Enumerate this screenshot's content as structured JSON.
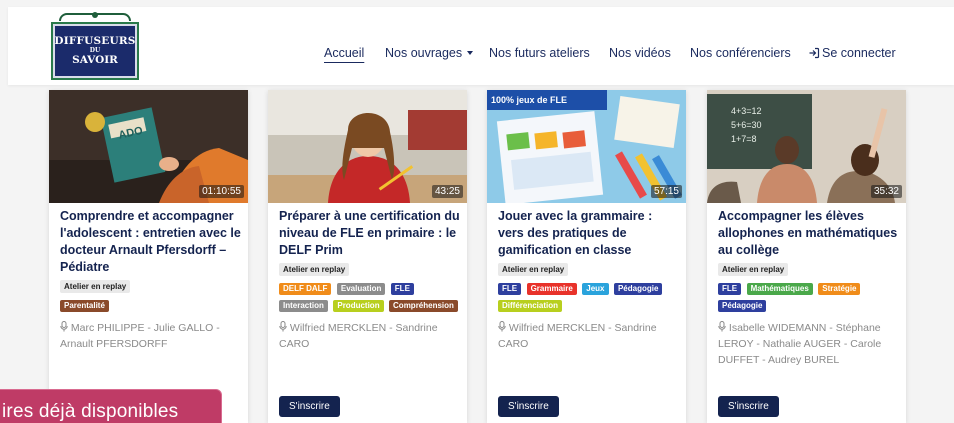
{
  "logo": {
    "line1": "DIFFUSEURS",
    "line2": "DU",
    "line3": "SAVOIR"
  },
  "nav": {
    "items": [
      {
        "label": "Accueil"
      },
      {
        "label": "Nos ouvrages"
      },
      {
        "label": "Nos futurs ateliers"
      },
      {
        "label": "Nos vidéos"
      },
      {
        "label": "Nos conférenciers"
      },
      {
        "label": "Se connecter"
      }
    ]
  },
  "cards": [
    {
      "title": "Comprendre et accompagner l'adolescent : entretien avec le docteur Arnault Pfersdorff – Pédiatre",
      "duration": "01:10:55",
      "badge": "Atelier en replay",
      "tags": [
        {
          "label": "Parentalité",
          "color": "#8a4a2a"
        }
      ],
      "speakers": "Marc PHILIPPE - Julie GALLO - Arnault PFERSDORFF",
      "button": ""
    },
    {
      "title": "Préparer à une certification du niveau de FLE en primaire : le DELF Prim",
      "duration": "43:25",
      "badge": "Atelier en replay",
      "tags": [
        {
          "label": "DELF DALF",
          "color": "#f08c1a"
        },
        {
          "label": "Evaluation",
          "color": "#8c8c8c"
        },
        {
          "label": "FLE",
          "color": "#2e3f9e"
        },
        {
          "label": "Interaction",
          "color": "#8c8c8c"
        },
        {
          "label": "Production",
          "color": "#b8cf1e"
        },
        {
          "label": "Compréhension",
          "color": "#8a4a2a"
        }
      ],
      "speakers": "Wilfried MERCKLEN - Sandrine CARO",
      "button": "S'inscrire"
    },
    {
      "title": "Jouer avec la grammaire : vers des pratiques de gamification en classe",
      "duration": "57:15",
      "badge": "Atelier en replay",
      "tags": [
        {
          "label": "FLE",
          "color": "#2e3f9e"
        },
        {
          "label": "Grammaire",
          "color": "#e8322a"
        },
        {
          "label": "Jeux",
          "color": "#2aa3dc"
        },
        {
          "label": "Pédagogie",
          "color": "#2e3f9e"
        },
        {
          "label": "Différenciation",
          "color": "#b8cf1e"
        }
      ],
      "speakers": "Wilfried MERCKLEN - Sandrine CARO",
      "button": "S'inscrire"
    },
    {
      "title": "Accompagner les élèves allophones en mathématiques au collège",
      "duration": "35:32",
      "badge": "Atelier en replay",
      "tags": [
        {
          "label": "FLE",
          "color": "#2e3f9e"
        },
        {
          "label": "Mathématiques",
          "color": "#4aa84a"
        },
        {
          "label": "Stratégie",
          "color": "#f08c1a"
        },
        {
          "label": "Pédagogie",
          "color": "#2e3f9e"
        }
      ],
      "speakers": "Isabelle WIDEMANN - Stéphane LEROY - Nathalie AUGER - Carole DUFFET - Audrey BUREL",
      "button": "S'inscrire"
    }
  ],
  "banner": {
    "text": "ires déjà disponibles"
  }
}
